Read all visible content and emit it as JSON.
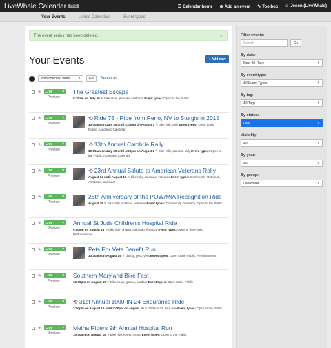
{
  "app": {
    "brand": "LiveWhale Calendar",
    "badge": "PRO",
    "nav": [
      {
        "icon": "☰",
        "label": "Calendar home"
      },
      {
        "icon": "⊕",
        "label": "Add an event"
      },
      {
        "icon": "✎",
        "label": "Toolbox"
      },
      {
        "icon": "☺",
        "label": "Jeson (LiveWhale)"
      }
    ]
  },
  "subnav": [
    "Your Events",
    "Linked Calendars",
    "Event types"
  ],
  "alert": {
    "message": "The event series has been deleted.",
    "close": "×"
  },
  "page": {
    "title": "Your Events",
    "add_button": "+ Add new"
  },
  "bulk": {
    "select_label": "With checked items ...",
    "go": "Go",
    "select_all": "Select all"
  },
  "row_common": {
    "status": "Live",
    "preview": "Preview"
  },
  "events": [
    {
      "title": "The Greatest Escape",
      "repeat": false,
      "thumb": false,
      "date": "6:30am on July 26",
      "tags": "bike race, glendale california",
      "types": "Open to the Public"
    },
    {
      "title": "Ride 75 - Ride from Reno, NV to Sturgis in 2015",
      "repeat": true,
      "thumb": true,
      "date": "10:00am on July 30 until 4:00pm on August 1",
      "tags": "bike ride, rally",
      "types": "Open to the Public, Academic Calendar"
    },
    {
      "title": "13th Annual Cambria Rally",
      "repeat": true,
      "thumb": true,
      "date": "10:30am on July 30 until 4:30pm on August 2",
      "tags": "bike rally, cambria rally",
      "types": "Open to the Public, Academic Calendar"
    },
    {
      "title": "23rd Annual Salute to American Veterans Rally",
      "repeat": true,
      "thumb": true,
      "date": "August 14 until August 16",
      "tags": "bike rally, colorado, veterans",
      "types": "Community Outreach, Academic Calendar"
    },
    {
      "title": "28th Anniversary of the POW/MIA Recognition Ride",
      "repeat": false,
      "thumb": true,
      "date": "August 15",
      "tags": "bike rally, soldiers, veterans",
      "types": "Community Outreach, Open to the Public"
    },
    {
      "title": "Annual St Jude Children's Hospital Ride",
      "repeat": false,
      "thumb": false,
      "date": "9:00am on August 15",
      "tags": "bike ride, charity, colorado, florence",
      "types": "Open to the Public, Performances"
    },
    {
      "title": "Pets For Vets Benefit Run",
      "repeat": false,
      "thumb": true,
      "date": "10:30am on August 15",
      "tags": "charity, pets, vets",
      "types": "Open to the Public, Performances"
    },
    {
      "title": "Southern Maryland Bike Fest",
      "repeat": false,
      "thumb": false,
      "date": "12:00pm on August 15",
      "tags": "bike show, games, outdoor",
      "types": "Open to the Public"
    },
    {
      "title": "31st Annual 1000-IN-24 Endurance Ride",
      "repeat": true,
      "thumb": false,
      "date": "2:00pm on August 15 until 4:00pm on August 16",
      "tags": "1000-in-24, bike ride",
      "types": "Open to the Public"
    },
    {
      "title": "Melha Riders 9th Annual Hospital Run",
      "repeat": false,
      "thumb": false,
      "date": "10:00am on August 15",
      "tags": "bike ride, items, music",
      "types": "Open to the Public"
    }
  ],
  "sidebar": {
    "filter_label": "Filter events:",
    "search_placeholder": "Search",
    "search_go": "Go",
    "filters": [
      {
        "label": "By date:",
        "value": "Next 30 Days",
        "highlight": false
      },
      {
        "label": "By event type:",
        "value": "All Event Types",
        "highlight": false
      },
      {
        "label": "By tag:",
        "value": "All Tags",
        "highlight": false
      },
      {
        "label": "By status:",
        "value": "Live",
        "highlight": true
      },
      {
        "label": "Visibility:",
        "value": "All",
        "highlight": false
      },
      {
        "label": "By year:",
        "value": "All",
        "highlight": false
      },
      {
        "label": "By group:",
        "value": "LiveWhale",
        "highlight": false
      }
    ]
  }
}
